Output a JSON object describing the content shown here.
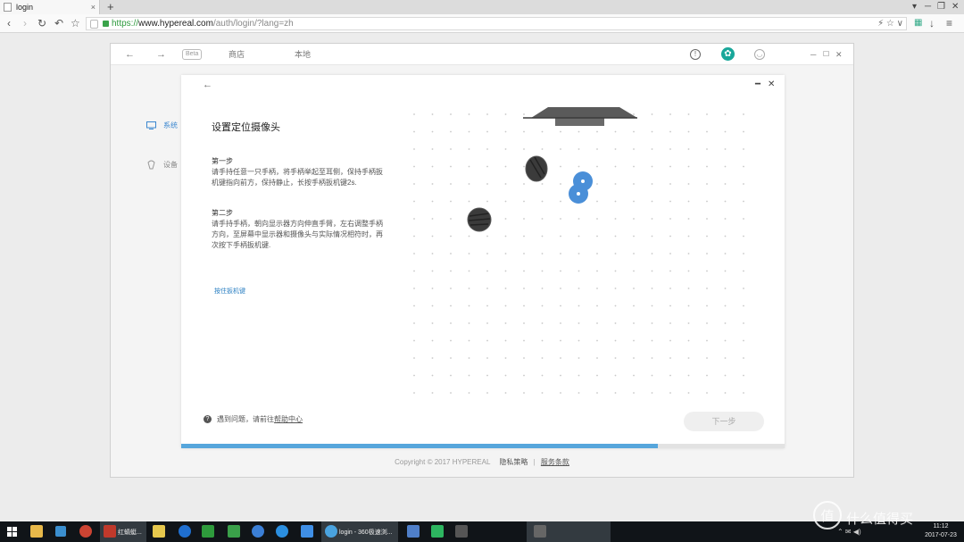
{
  "browser": {
    "tab_title": "login",
    "tab_close": "×",
    "new_tab": "+",
    "url_scheme": "https://",
    "url_host": "www.hypereal.com",
    "url_rest": "/auth/login/?lang=zh",
    "addr_right_icons": "⚡ ☆ ∨",
    "win_controls": [
      "▾",
      "─",
      "❐",
      "✕"
    ]
  },
  "app": {
    "header": {
      "back": "←",
      "forward": "→",
      "beta": "Beta",
      "store": "商店",
      "local": "本地",
      "window_controls": [
        "─",
        "☐",
        "✕"
      ]
    },
    "nav": {
      "items": [
        {
          "label": "系统​",
          "active": true
        },
        {
          "label": "设备​",
          "active": false
        }
      ]
    },
    "footer": {
      "copyright": "Copyright © 2017 HYPEREAL",
      "privacy": "隐私策略",
      "divider": "|",
      "terms": "服务条款"
    }
  },
  "dialog": {
    "back": "←",
    "minimize": "━",
    "close": "✕",
    "title": "设置定位摄像头",
    "step1_head": "第一步",
    "step1_body": "请手持任意一只手柄，将手柄举起至耳侧，保持手柄扳机键指向前方，保持静止，长按手柄扳机键2s.",
    "step2_head": "第二步",
    "step2_body": "请手持手柄，朝向显示器方向伸直手臂，左右调整手柄方向，至屏幕中显示器和摄像头与实际情况相符时，再次按下手柄扳机键.",
    "hold_link": "按住扳机键",
    "help_text": "遇到问题，请前往",
    "help_link": "帮助中心",
    "help_icon": "?",
    "next_button": "下一步",
    "progress": 0.79
  },
  "taskbar": {
    "items": [
      "红蜻蜓...",
      "login - 360极速浏..."
    ],
    "time": "11:12",
    "date": "2017-07-23"
  },
  "watermark": "值 什么值得买",
  "colors": {
    "accent_blue": "#4a8fd8",
    "progress_blue": "#56a6dc",
    "teal": "#19a79a",
    "link_blue": "#2a7fc2"
  }
}
